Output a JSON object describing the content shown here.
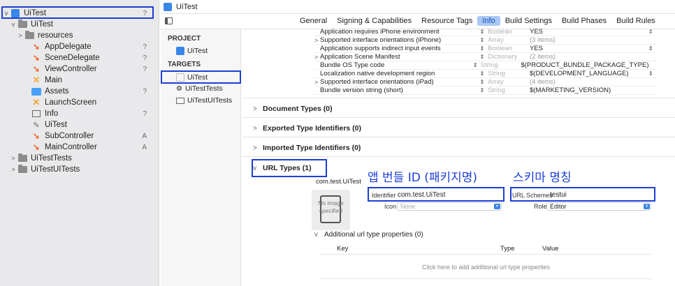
{
  "navigator": {
    "items": [
      {
        "label": "UiTest",
        "status": "?",
        "kind": "project",
        "chevron": "v",
        "indent": 0
      },
      {
        "label": "UiTest",
        "status": "",
        "kind": "folder",
        "chevron": "v",
        "indent": 1
      },
      {
        "label": "resources",
        "status": "",
        "kind": "folder",
        "chevron": ">",
        "indent": 2
      },
      {
        "label": "AppDelegate",
        "status": "?",
        "kind": "swift",
        "chevron": "",
        "indent": 3
      },
      {
        "label": "SceneDelegate",
        "status": "?",
        "kind": "swift",
        "chevron": "",
        "indent": 3
      },
      {
        "label": "ViewController",
        "status": "?",
        "kind": "swift",
        "chevron": "",
        "indent": 3
      },
      {
        "label": "Main",
        "status": "",
        "kind": "xib",
        "chevron": "",
        "indent": 3
      },
      {
        "label": "Assets",
        "status": "?",
        "kind": "assets",
        "chevron": "",
        "indent": 3
      },
      {
        "label": "LaunchScreen",
        "status": "",
        "kind": "xib",
        "chevron": "",
        "indent": 3
      },
      {
        "label": "Info",
        "status": "?",
        "kind": "plist",
        "chevron": "",
        "indent": 3
      },
      {
        "label": "UiTest",
        "status": "",
        "kind": "entitlements",
        "chevron": "",
        "indent": 3
      },
      {
        "label": "SubController",
        "status": "A",
        "kind": "swift",
        "chevron": "",
        "indent": 3
      },
      {
        "label": "MainController",
        "status": "A",
        "kind": "swift",
        "chevron": "",
        "indent": 3
      },
      {
        "label": "UiTestTests",
        "status": "",
        "kind": "folder",
        "chevron": ">",
        "indent": 1
      },
      {
        "label": "UiTestUITests",
        "status": "",
        "kind": "folder",
        "chevron": ">",
        "indent": 1
      }
    ]
  },
  "header": {
    "title": "UiTest",
    "tabs": [
      "General",
      "Signing & Capabilities",
      "Resource Tags",
      "Info",
      "Build Settings",
      "Build Phases",
      "Build Rules"
    ],
    "active_tab": "Info"
  },
  "targets_panel": {
    "project_heading": "PROJECT",
    "project_item": "UiTest",
    "targets_heading": "TARGETS",
    "targets": [
      "UiTest",
      "UiTestTests",
      "UiTestUITests"
    ]
  },
  "info_rows": [
    {
      "key": "Application requires iPhone environment",
      "expandable": false,
      "type": "Boolean",
      "value": "YES",
      "value_dim": false,
      "has_stepper": true
    },
    {
      "key": "Supported interface orientations (iPhone)",
      "expandable": true,
      "type": "Array",
      "value": "(3 items)",
      "value_dim": true,
      "has_stepper": false
    },
    {
      "key": "Application supports indirect input events",
      "expandable": false,
      "type": "Boolean",
      "value": "YES",
      "value_dim": false,
      "has_stepper": true
    },
    {
      "key": "Application Scene Manifest",
      "expandable": true,
      "type": "Dictionary",
      "value": "(2 items)",
      "value_dim": true,
      "has_stepper": false
    },
    {
      "key": "Bundle OS Type code",
      "expandable": false,
      "type": "String",
      "value": "$(PRODUCT_BUNDLE_PACKAGE_TYPE)",
      "value_dim": false,
      "has_stepper": false
    },
    {
      "key": "Localization native development region",
      "expandable": false,
      "type": "String",
      "value": "$(DEVELOPMENT_LANGUAGE)",
      "value_dim": false,
      "has_stepper": true
    },
    {
      "key": "Supported interface orientations (iPad)",
      "expandable": true,
      "type": "Array",
      "value": "(4 items)",
      "value_dim": true,
      "has_stepper": false
    },
    {
      "key": "Bundle version string (short)",
      "expandable": false,
      "type": "String",
      "value": "$(MARKETING_VERSION)",
      "value_dim": false,
      "has_stepper": false
    }
  ],
  "sections": {
    "document_types": "Document Types (0)",
    "exported_types": "Exported Type Identifiers (0)",
    "imported_types": "Imported Type Identifiers (0)",
    "url_types": "URL Types (1)"
  },
  "url_type": {
    "name": "com.test.UiTest",
    "identifier_label": "Identifier",
    "identifier_value": "com.test.UiTest",
    "icon_label": "Icon",
    "icon_placeholder": "None",
    "url_schemes_label": "URL Schemes",
    "url_schemes_value": "testui",
    "role_label": "Role",
    "role_value": "Editor",
    "no_image_text": "No image specified",
    "additional_props": "Additional url type properties (0)",
    "table_headers": {
      "key": "Key",
      "type": "Type",
      "value": "Value"
    },
    "empty_message": "Click here to add additional url type properties"
  },
  "annotations": {
    "bundle_id": "앱 번들 ID (패키지명)",
    "scheme_name": "스키마 명칭"
  },
  "colors": {
    "highlight": "#1c3ed6",
    "active_tab_bg": "#a9c8f6",
    "swift": "#f0622d"
  }
}
